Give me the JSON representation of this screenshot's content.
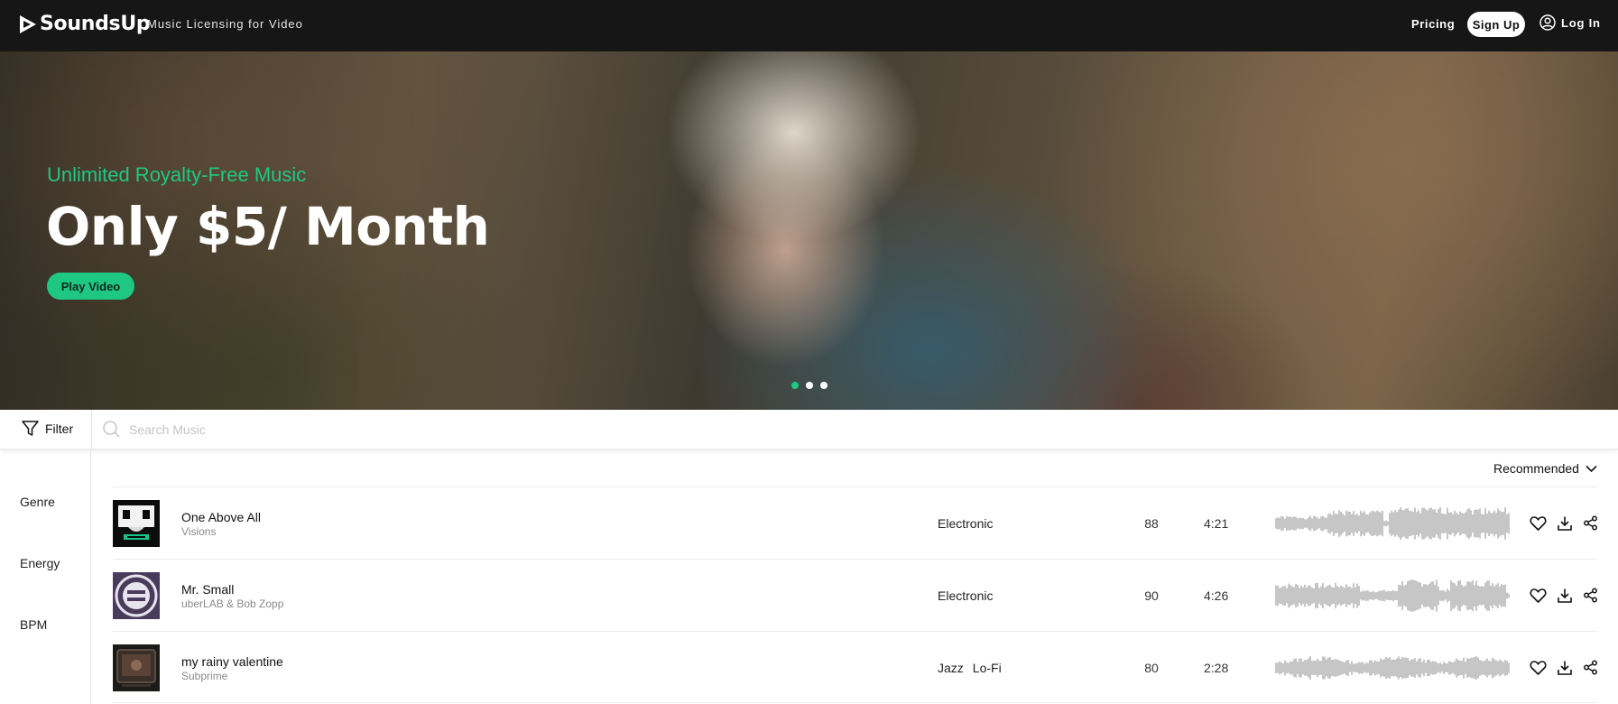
{
  "header": {
    "brand": "SoundsUp",
    "tagline": "Music Licensing for Video",
    "nav_pricing": "Pricing",
    "signup_label": "Sign Up",
    "login_label": "Log In"
  },
  "hero": {
    "subtitle": "Unlimited Royalty-Free Music",
    "title": "Only $5/ Month",
    "play_label": "Play Video",
    "slides": 3,
    "active_slide": 1
  },
  "search": {
    "filter_label": "Filter",
    "placeholder": "Search Music"
  },
  "sidebar": {
    "items": [
      {
        "label": "Genre"
      },
      {
        "label": "Energy"
      },
      {
        "label": "BPM"
      }
    ]
  },
  "sort": {
    "selected": "Recommended"
  },
  "tracks": [
    {
      "title": "One Above All",
      "artist": "Visions",
      "genres": [
        "Electronic"
      ],
      "bpm": "88",
      "duration": "4:21"
    },
    {
      "title": "Mr. Small",
      "artist": "uberLAB & Bob Zopp",
      "genres": [
        "Electronic"
      ],
      "bpm": "90",
      "duration": "4:26"
    },
    {
      "title": "my rainy valentine",
      "artist": "Subprime",
      "genres": [
        "Jazz",
        "Lo-Fi"
      ],
      "bpm": "80",
      "duration": "2:28"
    }
  ],
  "colors": {
    "accent": "#1ec883",
    "topbar": "#161616",
    "waveform": "#b8b8b8"
  },
  "icons": {
    "logo": "play-triangle-icon",
    "login": "user-icon",
    "filter": "funnel-icon",
    "search": "search-icon",
    "sort": "chevron-down-icon",
    "favorite": "heart-icon",
    "download": "download-icon",
    "share": "share-icon"
  }
}
